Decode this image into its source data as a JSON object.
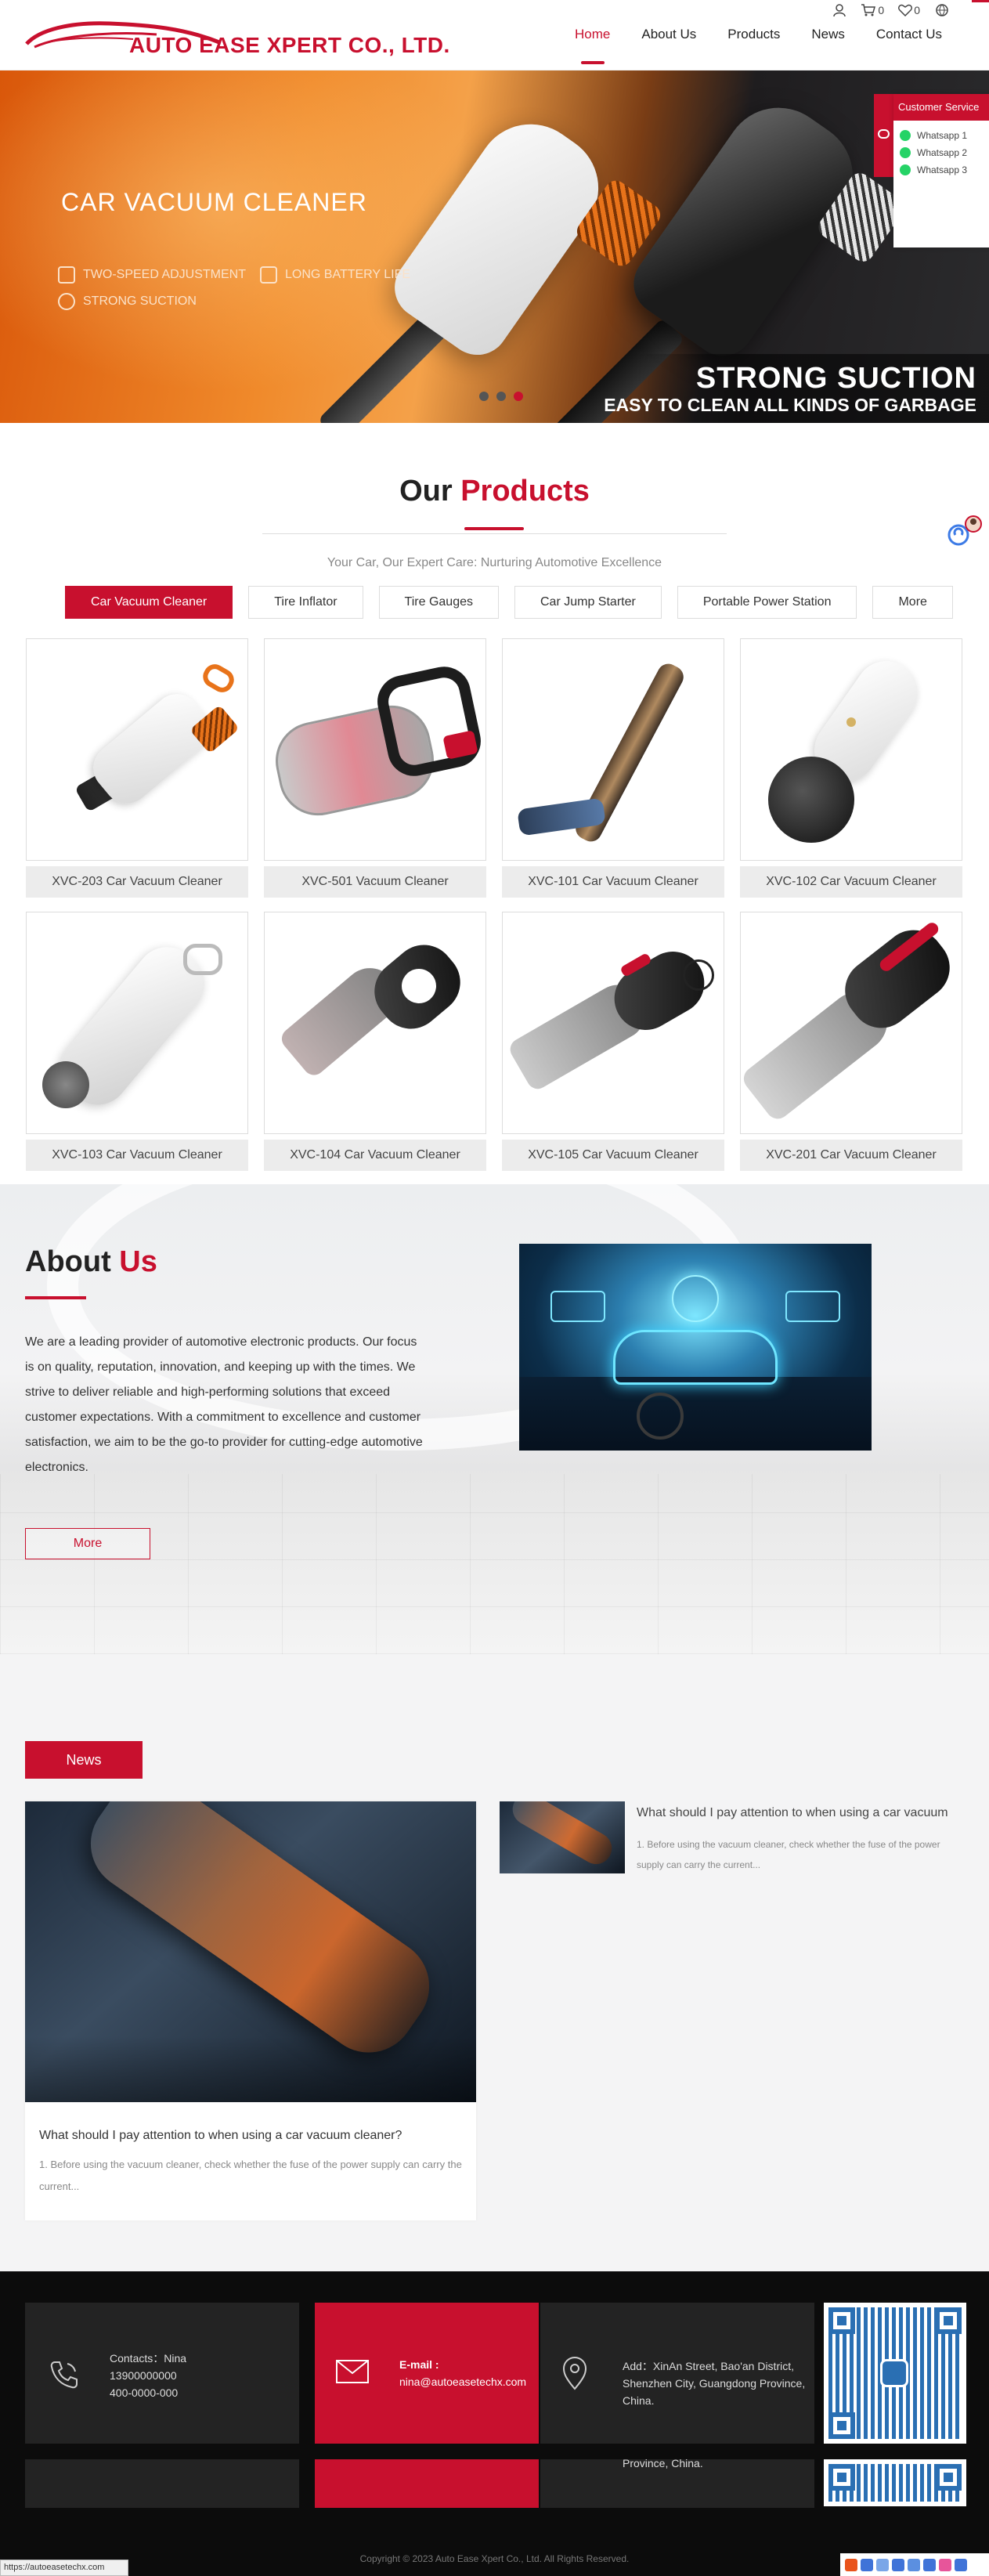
{
  "header": {
    "brand": "AUTO EASE XPERT CO., LTD.",
    "cart_count": "0",
    "wishlist_count": "0",
    "nav": [
      {
        "label": "Home",
        "active": true
      },
      {
        "label": "Products",
        "active": false
      },
      {
        "label": "Products",
        "active": false
      },
      {
        "label": "News",
        "active": false
      },
      {
        "label": "Contact Us",
        "active": false
      }
    ]
  },
  "nav": {
    "home": "Home",
    "about": "About Us",
    "products": "Products",
    "news": "News",
    "contact": "Contact Us"
  },
  "banner": {
    "title": "CAR VACUUM CLEANER",
    "features": [
      "TWO-SPEED ADJUSTMENT",
      "LONG BATTERY LIFE",
      "STRONG SUCTION"
    ],
    "headline": "STRONG SUCTION",
    "subheadline": "EASY TO CLEAN ALL KINDS OF GARBAGE",
    "slides": 3,
    "active_slide": 3
  },
  "customer_service": {
    "title": "Customer Service",
    "items": [
      "Whatsapp 1",
      "Whatsapp 2",
      "Whatsapp 3"
    ]
  },
  "products": {
    "title_part1": "Our",
    "title_part2": "Products",
    "subtitle": "Your Car, Our Expert Care: Nurturing Automotive Excellence",
    "tabs": [
      "Car Vacuum Cleaner",
      "Tire Inflator",
      "Tire Gauges",
      "Car Jump Starter",
      "Portable Power Station",
      "More"
    ],
    "items": [
      "XVC-203 Car Vacuum Cleaner",
      "XVC-501 Vacuum Cleaner",
      "XVC-101 Car Vacuum Cleaner",
      "XVC-102 Car Vacuum Cleaner",
      "XVC-103 Car Vacuum Cleaner",
      "XVC-104 Car Vacuum Cleaner",
      "XVC-105 Car Vacuum Cleaner",
      "XVC-201 Car Vacuum Cleaner"
    ]
  },
  "about": {
    "title_part1": "About",
    "title_part2": "Us",
    "text": "We are a leading provider of automotive electronic products. Our focus is on quality, reputation, innovation, and keeping up with the times. We strive to deliver reliable and high-performing solutions that exceed customer expectations. With a commitment to excellence and customer satisfaction, we aim to be the go-to provider for cutting-edge automotive electronics.",
    "more": "More"
  },
  "news": {
    "badge": "News",
    "main_title": "What should I pay attention to when using a car vacuum cleaner?",
    "main_desc": "1. Before using the vacuum cleaner, check whether the fuse of the power supply can carry the current...",
    "side_title": "What should I pay attention to when using a car vacuum",
    "side_desc": "1. Before using the vacuum cleaner, check whether the fuse of the power supply can carry the current..."
  },
  "footer": {
    "contacts_label": "Contacts：Nina",
    "phone1": "13900000000",
    "phone2": "400-0000-000",
    "email_label": "E-mail :",
    "email": "nina@autoeasetechx.com",
    "address": "Add：XinAn Street, Bao'an District, Shenzhen City, Guangdong Province, China.",
    "address_tail": "Province, China.",
    "copyright": "Copyright © 2023 Auto Ease Xpert Co., Ltd. All Rights Reserved."
  },
  "status_url": "https://autoeasetechx.com",
  "colors": {
    "accent": "#c8102e",
    "footer_bg": "#0c0c0c",
    "footer_box": "#232323"
  }
}
